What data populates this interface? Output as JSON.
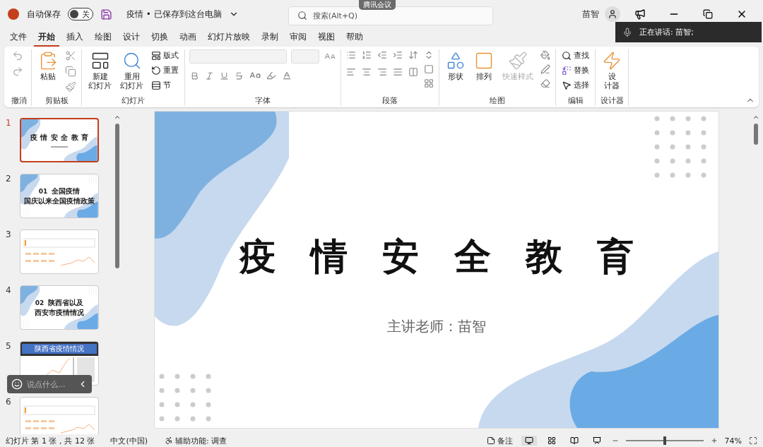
{
  "titlebar": {
    "autosave_label": "自动保存",
    "autosave": {
      "on": false,
      "label": "关"
    },
    "document_title": "疫情 • 已保存到这台电脑",
    "search": {
      "placeholder": "搜索(Alt+Q)"
    },
    "meeting_badge": "腾讯会议",
    "user_name": "苗智"
  },
  "speaking_banner": "正在讲话: 苗智;",
  "tabs": [
    {
      "label": "文件",
      "selected": false
    },
    {
      "label": "开始",
      "selected": true
    },
    {
      "label": "插入",
      "selected": false
    },
    {
      "label": "绘图",
      "selected": false
    },
    {
      "label": "设计",
      "selected": false
    },
    {
      "label": "切换",
      "selected": false
    },
    {
      "label": "动画",
      "selected": false
    },
    {
      "label": "幻灯片放映",
      "selected": false
    },
    {
      "label": "录制",
      "selected": false
    },
    {
      "label": "审阅",
      "selected": false
    },
    {
      "label": "视图",
      "selected": false
    },
    {
      "label": "帮助",
      "selected": false
    }
  ],
  "ribbon": [
    {
      "kind": "undo",
      "label": "撤消"
    },
    {
      "kind": "clipboard",
      "label": "剪贴板",
      "paste": "粘贴"
    },
    {
      "kind": "slides",
      "label": "幻灯片",
      "new_slide": [
        "新建",
        "幻灯片"
      ],
      "reuse": [
        "重用",
        "幻灯片"
      ],
      "layout": "版式",
      "reset": "重置",
      "section": "节"
    },
    {
      "kind": "font",
      "label": "字体"
    },
    {
      "kind": "paragraph",
      "label": "段落"
    },
    {
      "kind": "drawing",
      "label": "绘图",
      "shapes": "形状",
      "arrange": "排列",
      "quick_styles": "快速样式",
      "quick_styles_disabled": true
    },
    {
      "kind": "editing",
      "label": "编辑",
      "find": "查找",
      "replace": "替换",
      "select": "选择"
    },
    {
      "kind": "designer",
      "label": "设计器",
      "designer": [
        "设",
        "计器"
      ]
    }
  ],
  "slides": [
    {
      "number": "1",
      "selected": true,
      "kind": "title",
      "title": "疫 情 安 全 教 育"
    },
    {
      "number": "2",
      "selected": false,
      "kind": "section",
      "number_text": "01",
      "lines": [
        "全国疫情",
        "国庆以来全国疫情政策"
      ]
    },
    {
      "number": "3",
      "selected": false,
      "kind": "content"
    },
    {
      "number": "4",
      "selected": false,
      "kind": "section",
      "number_text": "02",
      "lines": [
        "陕西省以及",
        "西安市疫情情况"
      ]
    },
    {
      "number": "5",
      "selected": false,
      "kind": "banner",
      "header": "陕西省疫情情况"
    },
    {
      "number": "6",
      "selected": false,
      "kind": "content"
    }
  ],
  "chat_box": {
    "placeholder": "说点什么..."
  },
  "slide": {
    "title": "疫 情 安 全 教 育",
    "subtitle": "主讲老师：苗智"
  },
  "status_bar": {
    "slide_info": "幻灯片 第 1 张，共 12 张",
    "language": "中文(中国)",
    "accessibility": "辅助功能: 调查",
    "notes": "备注",
    "zoom": {
      "level": 0.5,
      "label": "74%"
    }
  }
}
